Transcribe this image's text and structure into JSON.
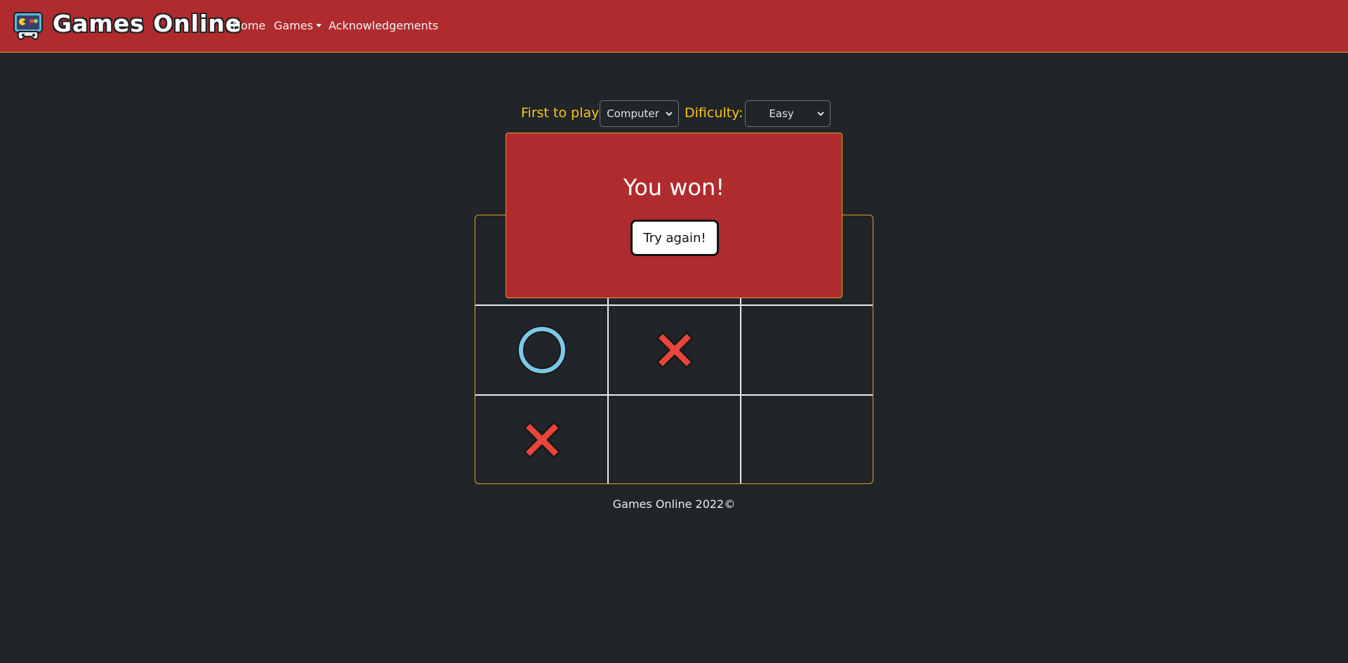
{
  "navbar": {
    "brand": "Games Online",
    "links": [
      "Home",
      "Games",
      "Acknowledgements"
    ]
  },
  "controls": {
    "first_label": "First to play:",
    "first_value": "Computer",
    "difficulty_label": "Dificulty:",
    "difficulty_value": "Easy"
  },
  "modal": {
    "title": "You won!",
    "button": "Try again!"
  },
  "board": {
    "cells": [
      "",
      "",
      "",
      "O",
      "X",
      "",
      "X",
      "",
      ""
    ]
  },
  "footer": "Games Online 2022©",
  "colors": {
    "nav_bg": "#b02b2e",
    "page_bg": "#212529",
    "accent_yellow": "#f5c518",
    "o_color": "#7cc8e8",
    "x_color": "#e8453c"
  },
  "icons": {
    "logo": "retro-game-console-icon",
    "o_mark": "circle-o-icon",
    "x_mark": "cross-x-icon"
  }
}
